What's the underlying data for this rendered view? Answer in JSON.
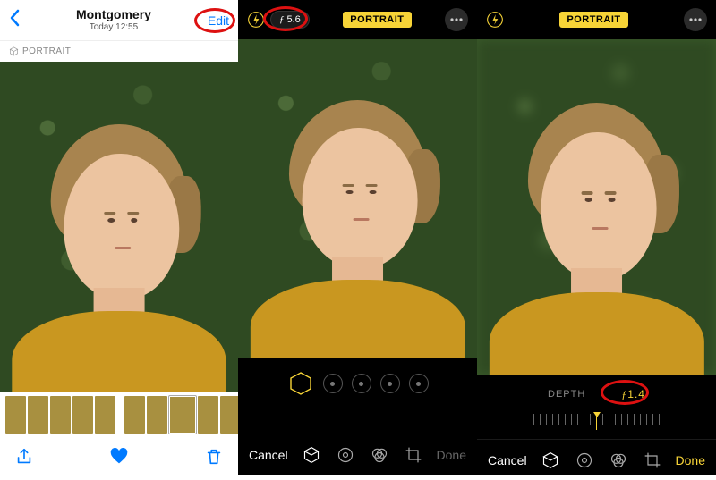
{
  "pane1": {
    "header": {
      "album_name": "Montgomery",
      "timestamp": "Today 12:55",
      "edit_label": "Edit"
    },
    "mode_tag": "PORTRAIT",
    "thumbnail_count": 10,
    "selected_thumbnail_index": 7,
    "toolbar": {
      "share": "share-icon",
      "favorite": "heart-icon",
      "delete": "trash-icon",
      "favorited": true
    }
  },
  "pane2": {
    "aperture_pill": {
      "symbol": "ƒ",
      "value": "5.6"
    },
    "mode_badge": "PORTRAIT",
    "effects_count": 5,
    "effects_selected_index": 0,
    "toolbar": {
      "cancel": "Cancel",
      "done": "Done"
    }
  },
  "pane3": {
    "mode_badge": "PORTRAIT",
    "depth": {
      "label": "DEPTH",
      "symbol": "ƒ",
      "value": "1.4"
    },
    "ruler_ticks": 21,
    "toolbar": {
      "cancel": "Cancel",
      "done": "Done"
    }
  },
  "colors": {
    "ios_blue": "#007aff",
    "edit_gold": "#f7d437",
    "annotation_red": "#d11"
  }
}
